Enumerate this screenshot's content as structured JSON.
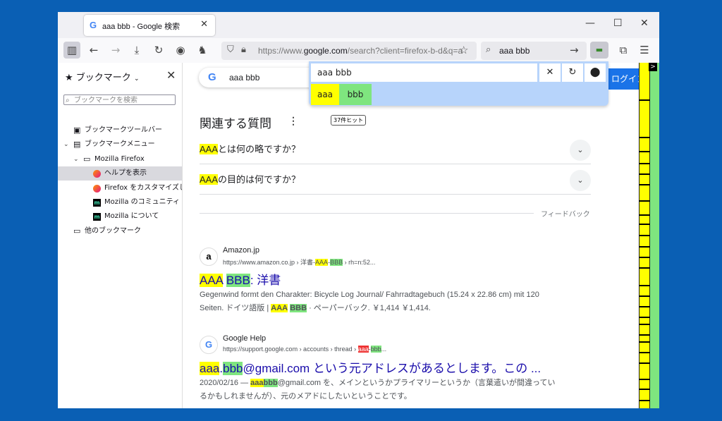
{
  "tab": {
    "title": "aaa bbb - Google 検索",
    "favicon": "G",
    "close": "✕"
  },
  "window_controls": {
    "minimize": "—",
    "maximize": "☐",
    "close": "✕"
  },
  "toolbar": {
    "url_prefix": "https://www.",
    "url_domain": "google.com",
    "url_rest": "/search?client=firefox-b-d&q=aaa+bbb",
    "search_text": "aaa bbb"
  },
  "sidebar": {
    "title": "ブックマーク",
    "search_placeholder": "ブックマークを検索",
    "items": [
      {
        "label": "ブックマークツールバー"
      },
      {
        "label": "ブックマークメニュー"
      },
      {
        "label": "Mozilla Firefox"
      },
      {
        "label": "ヘルプを表示"
      },
      {
        "label": "Firefox をカスタマイズし…"
      },
      {
        "label": "Mozilla のコミュニティ"
      },
      {
        "label": "Mozilla について"
      },
      {
        "label": "他のブックマーク"
      }
    ]
  },
  "google": {
    "query": "aaa bbb",
    "login_label": "ログイン",
    "paa_title": "関連する質問",
    "hit_count": "37件ヒット",
    "questions": [
      {
        "hl": "AAA",
        "rest": "とは何の略ですか？"
      },
      {
        "hl": "AAA",
        "rest": "の目的は何ですか？"
      }
    ],
    "feedback": "フィードバック",
    "results": [
      {
        "site": "Amazon.jp",
        "logo": "a",
        "cite_pre": "https://www.amazon.co.jp › 洋書-",
        "cite_hl1": "AAA",
        "cite_dash": "-",
        "cite_hl2": "BBB",
        "cite_post": " › rh=n:52...",
        "title_hl1": "AAA",
        "title_hl2": "BBB",
        "title_rest": ": 洋書",
        "snip1": "Gegenwind formt den Charakter: Bicycle Log Journal/ Fahrradtagebuch (15.24 x 22.86 cm) mit 120",
        "snip2_pre": "Seiten. ドイツ語版 | ",
        "snip2_hl1": "AAA",
        "snip2_hl2": "BBB",
        "snip2_post": " · ペーパーバック. ￥1,414 ￥1,414."
      },
      {
        "site": "Google Help",
        "logo": "G",
        "cite_pre": "https://support.google.com › accounts › thread › ",
        "cite_hl1": "aaa",
        "cite_dash": "-",
        "cite_hl2": "bbb",
        "cite_post": "...",
        "title_hl1": "aaa",
        "title_dot": ".",
        "title_hl2": "bbb",
        "title_rest": "@gmail.com という元アドレスがあるとします。この ...",
        "snip1_pre": "2020/02/16 — ",
        "snip1_hl1": "aaa",
        "snip1_hl2": "bbb",
        "snip1_post": "@gmail.com を、メインというかプライマリーというか（言葉遣いが間違ってい",
        "snip2": "るかもしれませんが）、元のメアドにしたいということです。"
      }
    ]
  },
  "finder": {
    "input": "aaa bbb",
    "chips": [
      "aaa",
      "bbb"
    ],
    "colors": {
      "aaa": "#ffff00",
      "bbb": "#7fe57f"
    }
  },
  "minimap_arrow": ">"
}
